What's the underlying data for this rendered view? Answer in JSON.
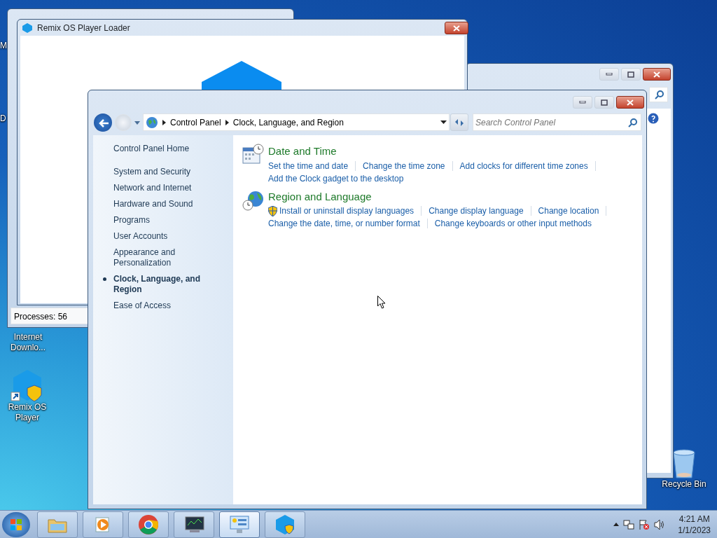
{
  "desktop_icons": [
    {
      "kind": "cut",
      "label": "M"
    },
    {
      "kind": "cut",
      "label": "D"
    },
    {
      "kind": "app",
      "label": "Internet Downlo..."
    },
    {
      "kind": "remix",
      "label": "Remix OS Player"
    },
    {
      "kind": "bin",
      "label": "Recycle Bin"
    }
  ],
  "task_manager": {
    "status": "Processes: 56"
  },
  "loader": {
    "title": "Remix OS Player Loader"
  },
  "control_panel": {
    "breadcrumb": [
      "Control Panel",
      "Clock, Language, and Region"
    ],
    "search": {
      "placeholder": "Search Control Panel"
    },
    "sidebar": [
      {
        "label": "Control Panel Home",
        "selected": false
      },
      {
        "label": "System and Security",
        "selected": false
      },
      {
        "label": "Network and Internet",
        "selected": false
      },
      {
        "label": "Hardware and Sound",
        "selected": false
      },
      {
        "label": "Programs",
        "selected": false
      },
      {
        "label": "User Accounts",
        "selected": false
      },
      {
        "label": "Appearance and Personalization",
        "selected": false
      },
      {
        "label": "Clock, Language, and Region",
        "selected": true
      },
      {
        "label": "Ease of Access",
        "selected": false
      }
    ],
    "categories": [
      {
        "kind": "clock",
        "title": "Date and Time",
        "lines": [
          [
            {
              "label": "Set the time and date",
              "shield": false
            },
            {
              "label": "Change the time zone",
              "shield": false
            },
            {
              "label": "Add clocks for different time zones",
              "shield": false
            }
          ],
          [
            {
              "label": "Add the Clock gadget to the desktop",
              "shield": false
            }
          ]
        ]
      },
      {
        "kind": "globe",
        "title": "Region and Language",
        "lines": [
          [
            {
              "label": "Install or uninstall display languages",
              "shield": true
            },
            {
              "label": "Change display language",
              "shield": false
            },
            {
              "label": "Change location",
              "shield": false
            }
          ],
          [
            {
              "label": "Change the date, time, or number format",
              "shield": false
            },
            {
              "label": "Change keyboards or other input methods",
              "shield": false
            }
          ]
        ]
      }
    ]
  },
  "taskbar": {
    "buttons": [
      {
        "kind": "folder",
        "selected": false
      },
      {
        "kind": "media",
        "selected": false
      },
      {
        "kind": "browser",
        "selected": false
      },
      {
        "kind": "monitor",
        "selected": false
      },
      {
        "kind": "panel",
        "selected": true
      },
      {
        "kind": "remix",
        "selected": false
      }
    ],
    "time": "4:21 AM",
    "date": "1/1/2023"
  }
}
